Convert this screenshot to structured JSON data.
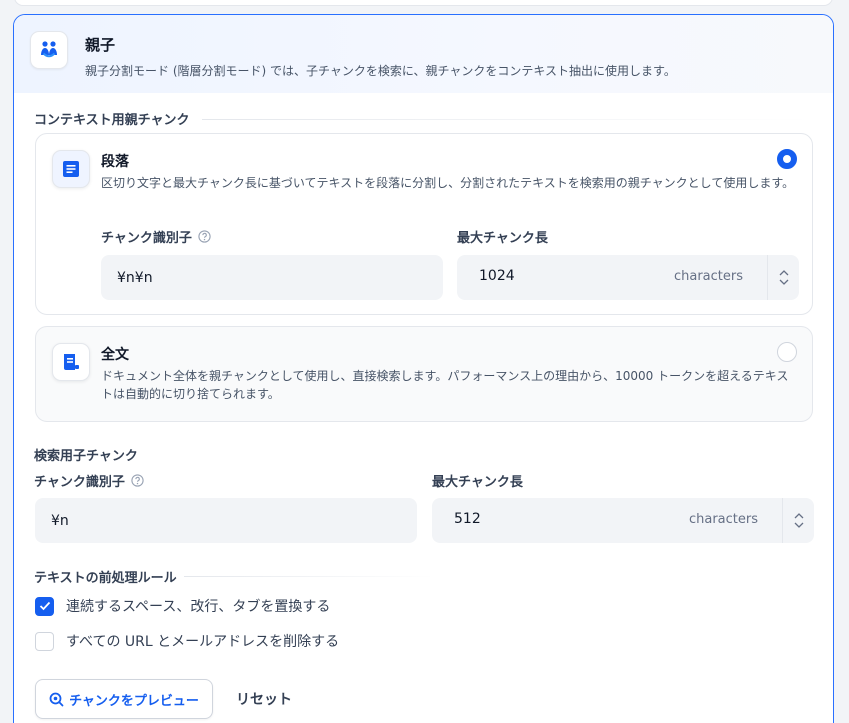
{
  "parent_child": {
    "title": "親子",
    "description": "親子分割モード (階層分割モード) では、子チャンクを検索に、親チャンクをコンテキスト抽出に使用します。"
  },
  "parent_section": {
    "label": "コンテキスト用親チャンク",
    "paragraph": {
      "title": "段落",
      "description": "区切り文字と最大チャンク長に基づいてテキストを段落に分割し、分割されたテキストを検索用の親チャンクとして使用します。",
      "selected": true,
      "delimiter_label": "チャンク識別子",
      "delimiter_value": "¥n¥n",
      "max_length_label": "最大チャンク長",
      "max_length_value": "1024",
      "unit": "characters"
    },
    "full_doc": {
      "title": "全文",
      "description": "ドキュメント全体を親チャンクとして使用し、直接検索します。パフォーマンス上の理由から、10000 トークンを超えるテキストは自動的に切り捨てられます。",
      "selected": false
    }
  },
  "child_section": {
    "label": "検索用子チャンク",
    "delimiter_label": "チャンク識別子",
    "delimiter_value": "¥n",
    "max_length_label": "最大チャンク長",
    "max_length_value": "512",
    "unit": "characters"
  },
  "rules": {
    "label": "テキストの前処理ルール",
    "items": [
      {
        "label": "連続するスペース、改行、タブを置換する",
        "checked": true
      },
      {
        "label": "すべての URL とメールアドレスを削除する",
        "checked": false
      }
    ]
  },
  "actions": {
    "preview_label": "チャンクをプレビュー",
    "reset_label": "リセット"
  },
  "colors": {
    "accent": "#155eef",
    "border_active": "#2970ff"
  }
}
